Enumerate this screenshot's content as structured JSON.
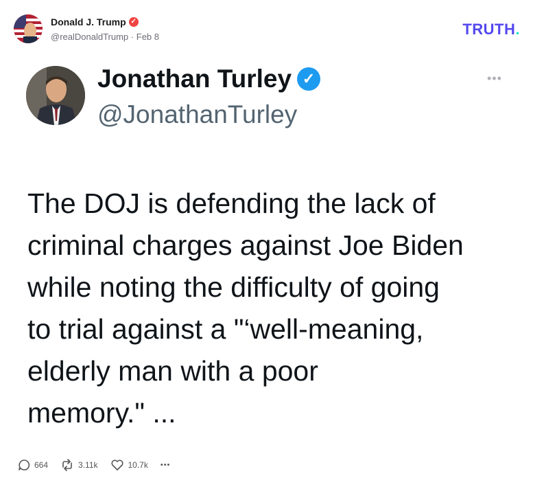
{
  "post": {
    "author_name": "Donald J. Trump",
    "author_handle": "@realDonaldTrump",
    "separator": "·",
    "date": "Feb 8",
    "brand": "TRUTH",
    "brand_dot": "."
  },
  "quoted": {
    "name": "Jonathan Turley",
    "handle": "@JonathanTurley",
    "more": "•••",
    "lines": [
      "The DOJ is defending the lack of",
      "criminal charges against Joe Biden",
      "while noting the difficulty of going",
      "to trial against a \"‘well-meaning,",
      "elderly man with a poor",
      "memory.\" ..."
    ]
  },
  "actions": {
    "replies": "664",
    "retruths": "3.11k",
    "likes": "10.7k",
    "more": "•••"
  },
  "colors": {
    "brand": "#5448ee",
    "brand_dot": "#17e6c8",
    "author_badge": "#ef4444",
    "verified": "#1d9bf0"
  },
  "icons": [
    "verified-badge-icon",
    "verified-check-icon",
    "reply-icon",
    "retruth-icon",
    "like-icon",
    "more-icon"
  ]
}
